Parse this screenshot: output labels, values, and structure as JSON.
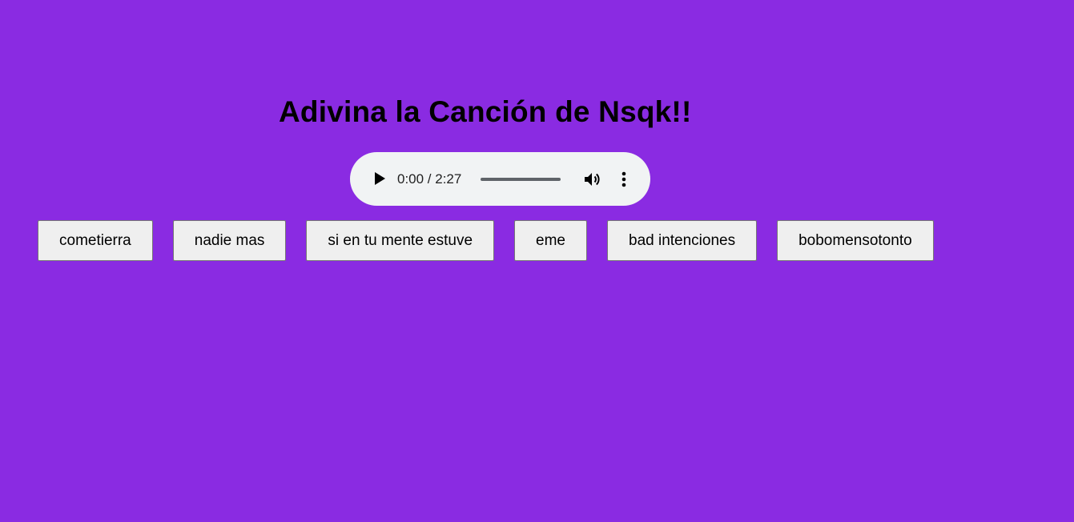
{
  "page": {
    "background_color": "#8a2be2",
    "title": "Adivina la Canción de Nsqk!!"
  },
  "audio_player": {
    "current_time": "0:00",
    "duration": "2:27",
    "time_display": "0:00 / 2:27",
    "progress_fraction": 0,
    "background_color": "#f1f3f4",
    "icons": {
      "play": "play-icon",
      "volume": "volume-icon",
      "more": "more-options-icon"
    }
  },
  "options": [
    {
      "label": "cometierra"
    },
    {
      "label": "nadie mas"
    },
    {
      "label": "si en tu mente estuve"
    },
    {
      "label": "eme"
    },
    {
      "label": "bad intenciones"
    },
    {
      "label": "bobomensotonto"
    }
  ]
}
